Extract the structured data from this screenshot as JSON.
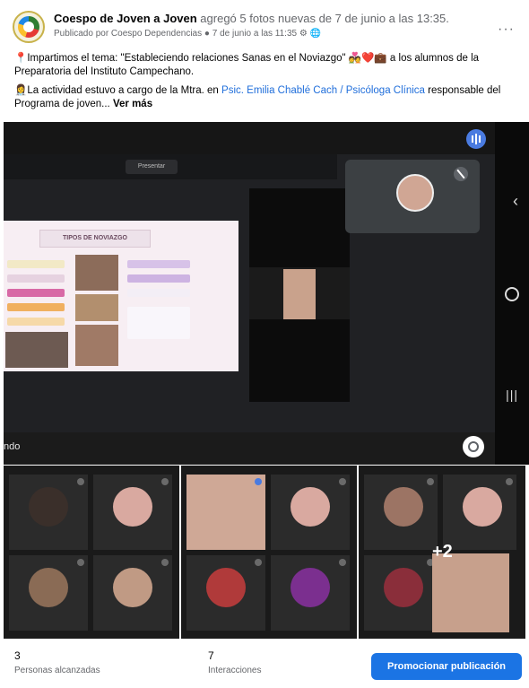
{
  "post": {
    "author": "Coespo de Joven a Joven",
    "action": "agregó 5 fotos nuevas",
    "when_prefix": "de",
    "when": "7 de junio a las 13:35.",
    "published_by": "Publicado por Coespo Dependencias",
    "date": "7 de junio a las 11:35",
    "more": "···"
  },
  "caption": {
    "line1": "📍Impartimos el tema: \"Estableciendo relaciones Sanas en el Noviazgo\" 💑❤️💼 a los alumnos de la Preparatoria del Instituto Campechano.",
    "line2_prefix": "👩‍⚕️La actividad estuvo a cargo de la Mtra. en",
    "line2_link": "Psic. Emilia Chablé Cach / Psicóloga Clínica",
    "line2_suffix": "responsable del Programa de joven...",
    "see_more": "Ver más"
  },
  "meeting": {
    "present_pill": "Presentar",
    "slide_title": "TIPOS DE NOVIAZGO",
    "bottom_text": "ndo"
  },
  "gallery": {
    "extra_count": "+2"
  },
  "footer": {
    "reach_num": "3",
    "reach_label": "Personas alcanzadas",
    "interactions_num": "7",
    "interactions_label": "Interacciones",
    "promote_label": "Promocionar publicación"
  }
}
